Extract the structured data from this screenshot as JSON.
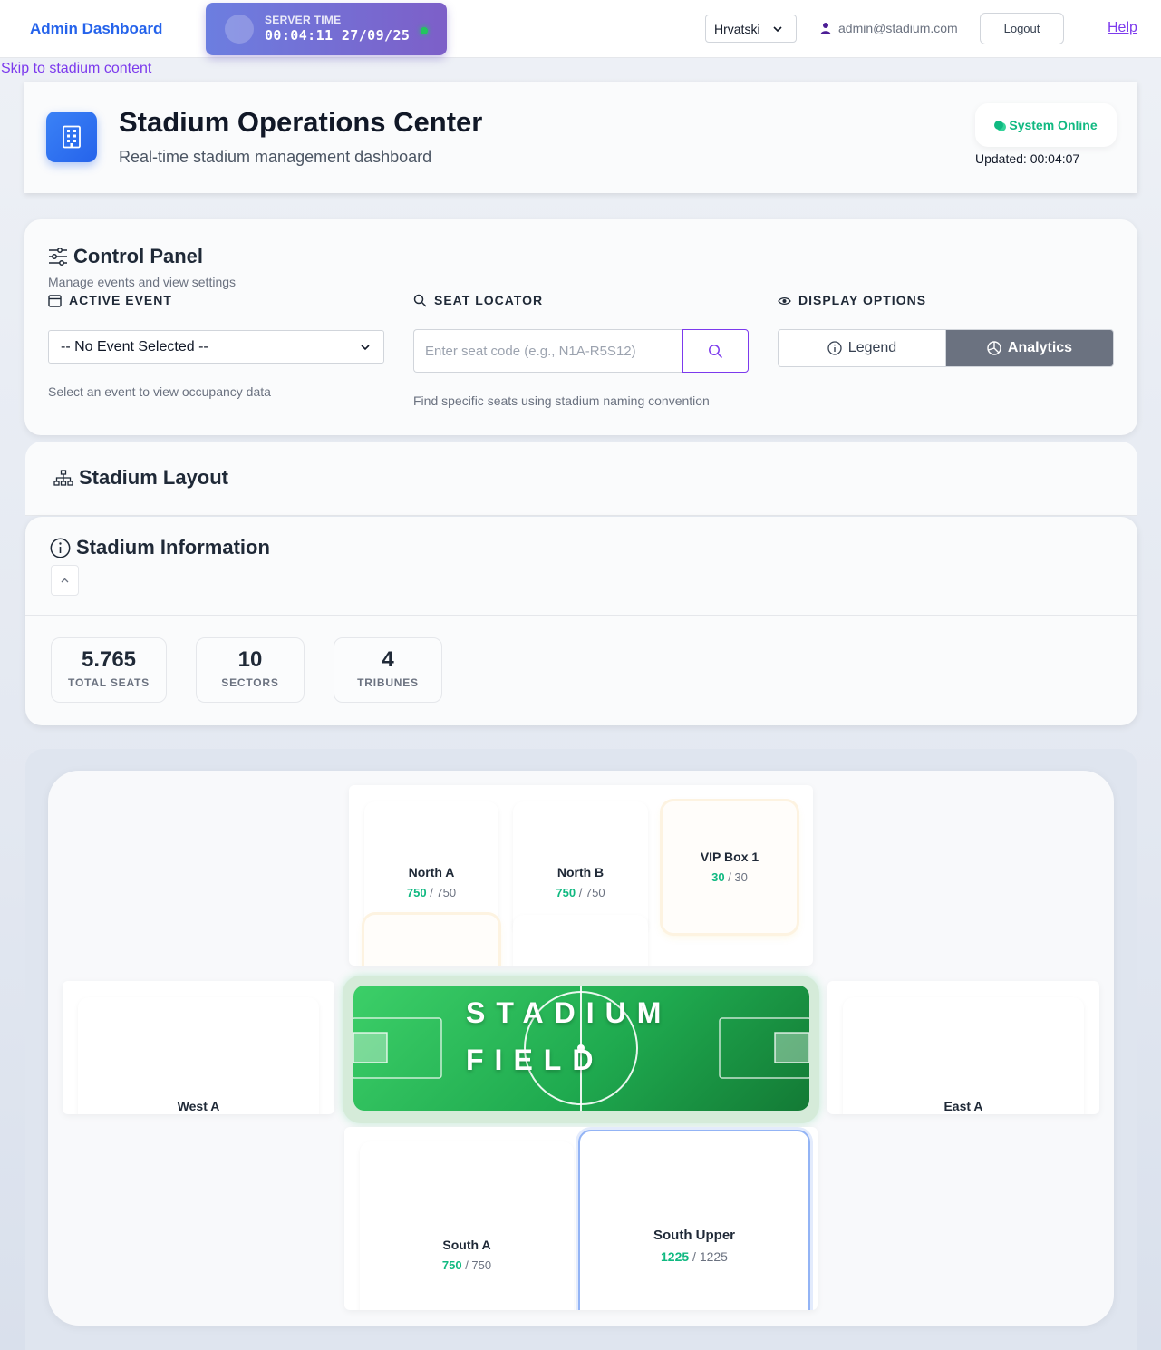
{
  "topbar": {
    "brand": "Admin Dashboard",
    "server_time_label": "SERVER TIME",
    "server_time_value": "00:04:11 27/09/25",
    "language": "Hrvatski",
    "user_email": "admin@stadium.com",
    "logout_label": "Logout",
    "help_label": "Help"
  },
  "skip_link": "Skip to stadium content",
  "header": {
    "title": "Stadium Operations Center",
    "subtitle": "Real-time stadium management dashboard",
    "status": "System Online",
    "updated": "Updated: 00:04:07"
  },
  "control_panel": {
    "title": "Control Panel",
    "subtitle": "Manage events and view settings",
    "active_event": {
      "label": "ACTIVE EVENT",
      "selected": "-- No Event Selected --",
      "help": "Select an event to view occupancy data"
    },
    "seat_locator": {
      "label": "SEAT LOCATOR",
      "placeholder": "Enter seat code (e.g., N1A-R5S12)",
      "help": "Find specific seats using stadium naming convention"
    },
    "display_options": {
      "label": "DISPLAY OPTIONS",
      "legend": "Legend",
      "analytics": "Analytics",
      "active": "Analytics"
    }
  },
  "layout": {
    "title": "Stadium Layout"
  },
  "info": {
    "title": "Stadium Information",
    "stats": [
      {
        "value": "5.765",
        "label": "TOTAL SEATS"
      },
      {
        "value": "10",
        "label": "SECTORS"
      },
      {
        "value": "4",
        "label": "TRIBUNES"
      }
    ]
  },
  "map": {
    "field_line1": "STADIUM",
    "field_line2": "FIELD",
    "sectors": {
      "north_a": {
        "name": "North A",
        "available": "750",
        "total": "750"
      },
      "north_b": {
        "name": "North B",
        "available": "750",
        "total": "750"
      },
      "vip_box_1": {
        "name": "VIP Box 1",
        "available": "30",
        "total": "30"
      },
      "west_a": {
        "name": "West A"
      },
      "east_a": {
        "name": "East A"
      },
      "south_a": {
        "name": "South A",
        "available": "750",
        "total": "750"
      },
      "south_upper": {
        "name": "South Upper",
        "available": "1225",
        "total": "1225"
      }
    }
  },
  "colors": {
    "brand": "#2563eb",
    "accent_purple": "#7c3aed",
    "online_green": "#10b981",
    "field_green": "#1faa4f"
  }
}
